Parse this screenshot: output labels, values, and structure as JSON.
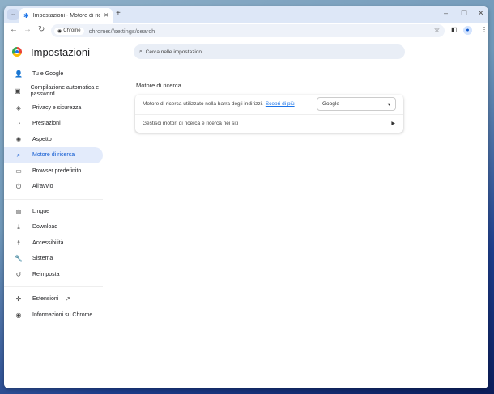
{
  "window": {
    "tab_title": "Impostazioni - Motore di ricerca",
    "new_tab": "+",
    "minimize": "–",
    "maximize": "☐",
    "close": "✕",
    "tab_close": "✕"
  },
  "toolbar": {
    "chip": "Chrome",
    "url": "chrome://settings/search"
  },
  "header": {
    "title": "Impostazioni",
    "search_placeholder": "Cerca nelle impostazioni"
  },
  "sidebar": {
    "items": [
      {
        "label": "Tu e Google",
        "icon": "person-icon",
        "glyph": "👤"
      },
      {
        "label": "Compilazione automatica e password",
        "icon": "clipboard-icon",
        "glyph": "▣"
      },
      {
        "label": "Privacy e sicurezza",
        "icon": "shield-icon",
        "glyph": "◈"
      },
      {
        "label": "Prestazioni",
        "icon": "speedometer-icon",
        "glyph": "◔"
      },
      {
        "label": "Aspetto",
        "icon": "palette-icon",
        "glyph": "✺"
      },
      {
        "label": "Motore di ricerca",
        "icon": "search-icon",
        "glyph": "⌕"
      },
      {
        "label": "Browser predefinito",
        "icon": "browser-icon",
        "glyph": "▭"
      },
      {
        "label": "All'avvio",
        "icon": "power-icon",
        "glyph": "⏻"
      },
      {
        "label": "Lingue",
        "icon": "globe-icon",
        "glyph": "◍"
      },
      {
        "label": "Download",
        "icon": "download-icon",
        "glyph": "⤓"
      },
      {
        "label": "Accessibilità",
        "icon": "accessibility-icon",
        "glyph": "☨"
      },
      {
        "label": "Sistema",
        "icon": "wrench-icon",
        "glyph": "🔧"
      },
      {
        "label": "Reimposta",
        "icon": "reset-icon",
        "glyph": "↺"
      },
      {
        "label": "Estensioni",
        "icon": "puzzle-icon",
        "glyph": "✤"
      },
      {
        "label": "Informazioni su Chrome",
        "icon": "chrome-icon",
        "glyph": "◉"
      }
    ]
  },
  "main": {
    "section_title": "Motore di ricerca",
    "engine_label": "Motore di ricerca utilizzato nella barra degli indirizzi.",
    "learn_more": "Scopri di più",
    "engine_value": "Google",
    "manage_label": "Gestisci motori di ricerca e ricerca nei siti"
  }
}
